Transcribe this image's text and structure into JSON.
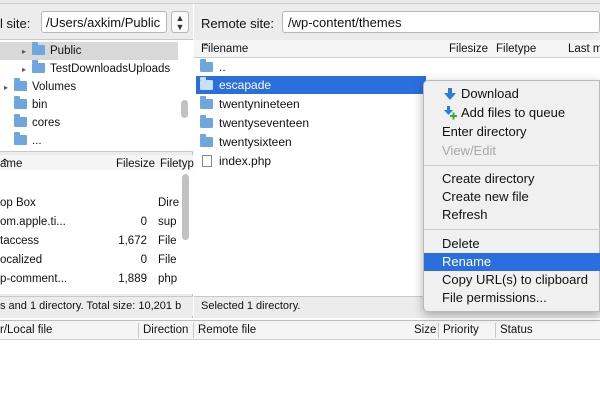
{
  "local": {
    "label": "l site:",
    "path": "/Users/axkim/Public",
    "tree": [
      {
        "label": "Public",
        "selected": true,
        "expander": "▸"
      },
      {
        "label": "TestDownloadsUploads",
        "selected": false,
        "expander": "▸"
      },
      {
        "label": "Volumes",
        "selected": false,
        "expander": "▸"
      },
      {
        "label": "bin",
        "selected": false,
        "expander": ""
      },
      {
        "label": "cores",
        "selected": false,
        "expander": ""
      },
      {
        "label": "...",
        "selected": false,
        "expander": ""
      }
    ],
    "columns": {
      "name": "ame",
      "size": "Filesize",
      "type": "Filetyp"
    },
    "files": [
      {
        "name": "op Box",
        "size": "",
        "type": "Dire"
      },
      {
        "name": "om.apple.ti...",
        "size": "0",
        "type": "sup"
      },
      {
        "name": "taccess",
        "size": "1,672",
        "type": "File"
      },
      {
        "name": "ocalized",
        "size": "0",
        "type": "File"
      },
      {
        "name": "p-comment...",
        "size": "1,889",
        "type": "php"
      }
    ],
    "status": "s and 1 directory. Total size: 10,201 b"
  },
  "remote": {
    "label": "Remote site:",
    "path": "/wp-content/themes",
    "columns": {
      "name": "Filename",
      "size": "Filesize",
      "type": "Filetype",
      "modified": "Last m"
    },
    "files": [
      {
        "name": "..",
        "kind": "folder",
        "selected": false
      },
      {
        "name": "escapade",
        "kind": "folder",
        "selected": true
      },
      {
        "name": "twentynineteen",
        "kind": "folder",
        "selected": false
      },
      {
        "name": "twentyseventeen",
        "kind": "folder",
        "selected": false
      },
      {
        "name": "twentysixteen",
        "kind": "folder",
        "selected": false
      },
      {
        "name": "index.php",
        "kind": "file",
        "selected": false
      }
    ],
    "status": "Selected 1 directory."
  },
  "context_menu": {
    "download": "Download",
    "add_queue": "Add files to queue",
    "enter_dir": "Enter directory",
    "view_edit": "View/Edit",
    "create_dir": "Create directory",
    "create_file": "Create new file",
    "refresh": "Refresh",
    "delete": "Delete",
    "rename": "Rename",
    "copy_url": "Copy URL(s) to clipboard",
    "permissions": "File permissions...",
    "highlighted": "Rename"
  },
  "queue": {
    "local_file": "r/Local file",
    "direction": "Direction",
    "remote_file": "Remote file",
    "size": "Size",
    "priority": "Priority",
    "status": "Status"
  },
  "colors": {
    "selection": "#2a6fdd",
    "folder": "#6fa6df",
    "download_arrow": "#2a7fd8",
    "add_plus": "#3aa845"
  },
  "icons": {
    "sort": "chevron-up-icon",
    "download": "download-arrow-icon",
    "add": "add-to-queue-icon"
  }
}
